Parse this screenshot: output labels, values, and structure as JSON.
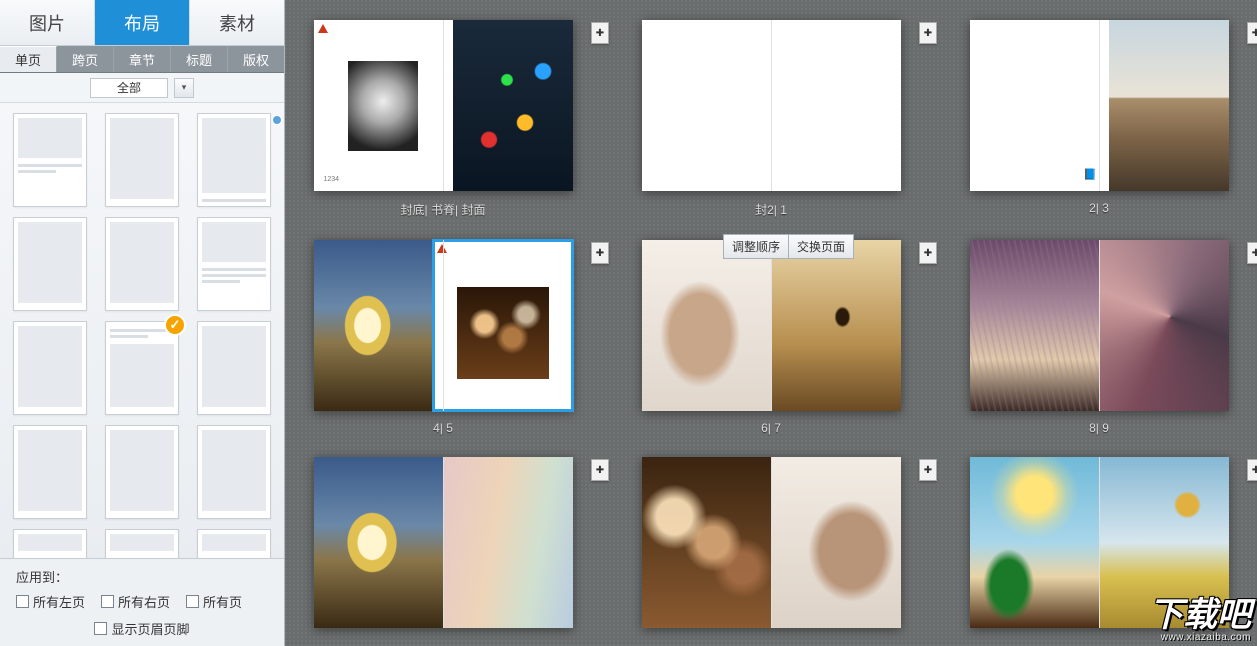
{
  "sidebar": {
    "main_tabs": {
      "t0": "图片",
      "t1": "布局",
      "t2": "素材",
      "active": 1
    },
    "sub_tabs": {
      "s0": "单页",
      "s1": "跨页",
      "s2": "章节",
      "s3": "标题",
      "s4": "版权",
      "active": 0
    },
    "filter": {
      "label": "全部",
      "dropdown_glyph": "▾"
    },
    "apply": {
      "title": "应用到：",
      "left": "所有左页",
      "right": "所有右页",
      "all": "所有页",
      "show_hf": "显示页眉页脚"
    }
  },
  "context_menu": {
    "reorder": "调整顺序",
    "swap": "交换页面"
  },
  "spreads": [
    {
      "label": "封底| 书脊| 封面",
      "add": true
    },
    {
      "label": "封2| 1",
      "add": true
    },
    {
      "label": "2| 3",
      "add": true
    },
    {
      "label": "4| 5",
      "add": true
    },
    {
      "label": "6| 7",
      "add": true
    },
    {
      "label": "8| 9",
      "add": true
    }
  ],
  "watermark": {
    "main": "下载吧",
    "sub": "www.xiazaiba.com"
  },
  "icons": {
    "add": "✚",
    "check": "✓"
  },
  "tiny_text": "1234"
}
